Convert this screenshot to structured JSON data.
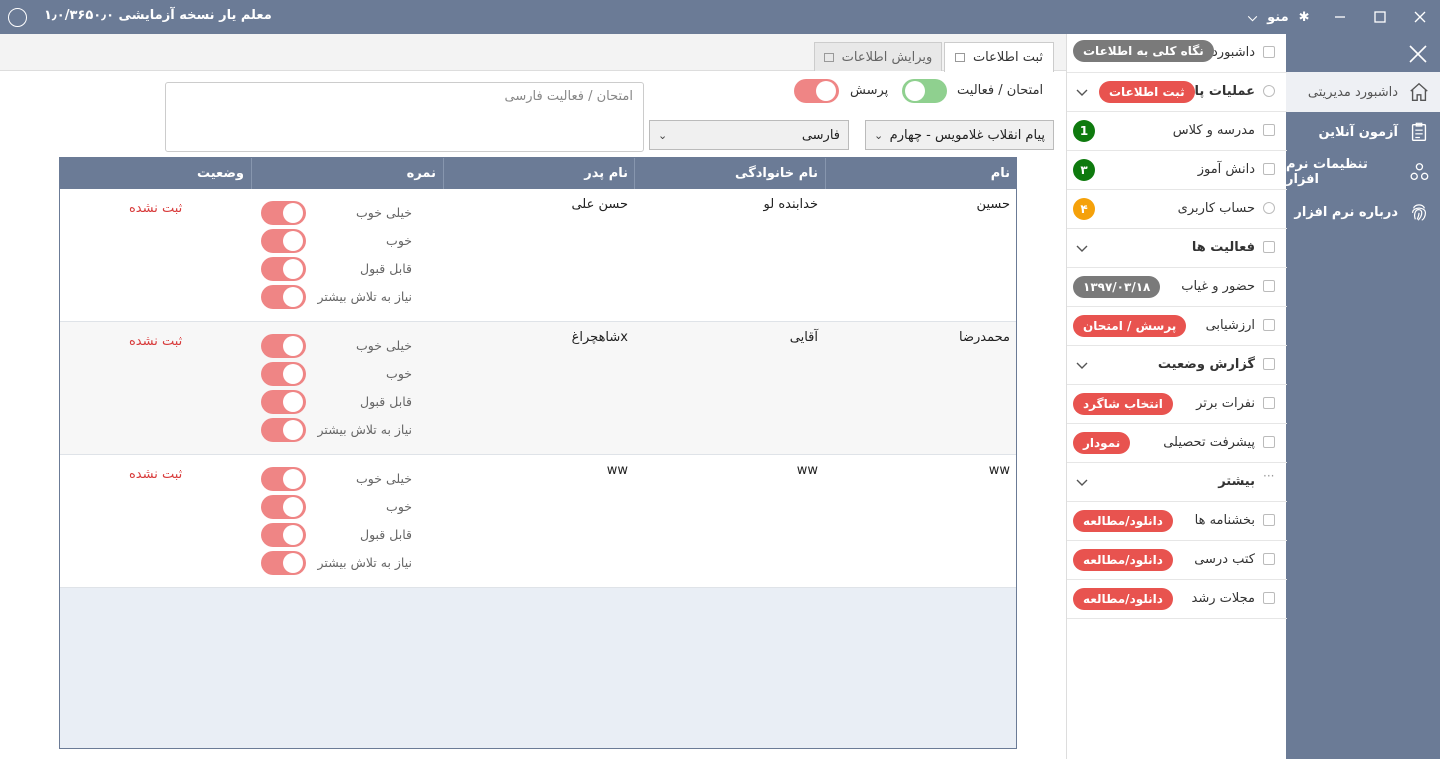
{
  "titlebar": {
    "title": "معلم یار نسخه آزمایشی ۱٫۰/۳۶۵۰٫۰",
    "menu_label": "منو"
  },
  "rightnav": {
    "items": [
      {
        "label": "داشبورد مدیریتی",
        "icon": "home-icon"
      },
      {
        "label": "آزمون آنلاین",
        "icon": "clipboard-icon"
      },
      {
        "label": "تنظیمات نرم افزار",
        "icon": "settings-nodes-icon"
      },
      {
        "label": "درباره نرم افزار",
        "icon": "fingerprint-icon"
      }
    ]
  },
  "midpanel": {
    "rows": [
      {
        "label": "داشبورد",
        "pill": "نگاه کلی به اطلاعات"
      },
      {
        "label": "عملیات پایه",
        "pill": "ثبت اطلاعات"
      },
      {
        "label": "مدرسه و کلاس",
        "badge": "1"
      },
      {
        "label": "دانش آموز",
        "badge": "۳"
      },
      {
        "label": "حساب کاربری",
        "badge": "۴"
      },
      {
        "label": "فعالیت ها"
      },
      {
        "label": "حضور و غیاب",
        "pill": "۱۳۹۷/۰۳/۱۸"
      },
      {
        "label": "ارزشیابی",
        "pill": "پرسش / امتحان"
      },
      {
        "label": "گزارش وضعیت"
      },
      {
        "label": "نفرات برتر",
        "pill": "انتخاب شاگرد"
      },
      {
        "label": "پیشرفت تحصیلی",
        "pill": "نمودار"
      },
      {
        "label": "بیشتر"
      },
      {
        "label": "بخشنامه ها",
        "pill": "دانلود/مطالعه"
      },
      {
        "label": "کتب درسی",
        "pill": "دانلود/مطالعه"
      },
      {
        "label": "مجلات رشد",
        "pill": "دانلود/مطالعه"
      }
    ],
    "colors": {
      "gray_pill": "#7a7a7a",
      "red_pill": "#e8534f",
      "green_badge": "#0e7a0e",
      "orange_badge": "#f5a10a"
    }
  },
  "tabs": {
    "active": "ثبت اطلاعات",
    "inactive": "ویرایش اطلاعات"
  },
  "form": {
    "exam_activity_label": "امتحان / فعالیت",
    "quiz_label": "پرسش",
    "textarea_placeholder": "امتحان / فعالیت فارسی",
    "class_select": "پیام انقلاب غلامویس - چهارم",
    "subject_select": "فارسی"
  },
  "table": {
    "headers": {
      "name": "نام",
      "family": "نام خانوادگی",
      "father": "نام پدر",
      "grade": "نمره",
      "status": "وضعیت"
    },
    "grade_options": [
      "خیلی خوب",
      "خوب",
      "قابل قبول",
      "نیاز به تلاش بیشتر"
    ],
    "rows": [
      {
        "name": "حسین",
        "family": "خدابنده لو",
        "father": "حسن علی",
        "status": "ثبت نشده"
      },
      {
        "name": "محمدرضا",
        "family": "آقایی",
        "father": "شاهچراغx",
        "status": "ثبت نشده"
      },
      {
        "name": "ww",
        "family": "ww",
        "father": "ww",
        "status": "ثبت نشده"
      }
    ]
  },
  "theme": {
    "accent": "#6b7b96",
    "status_red": "#d83a3a",
    "toggle_red": "#ef8585",
    "toggle_green": "#8fd08f"
  }
}
